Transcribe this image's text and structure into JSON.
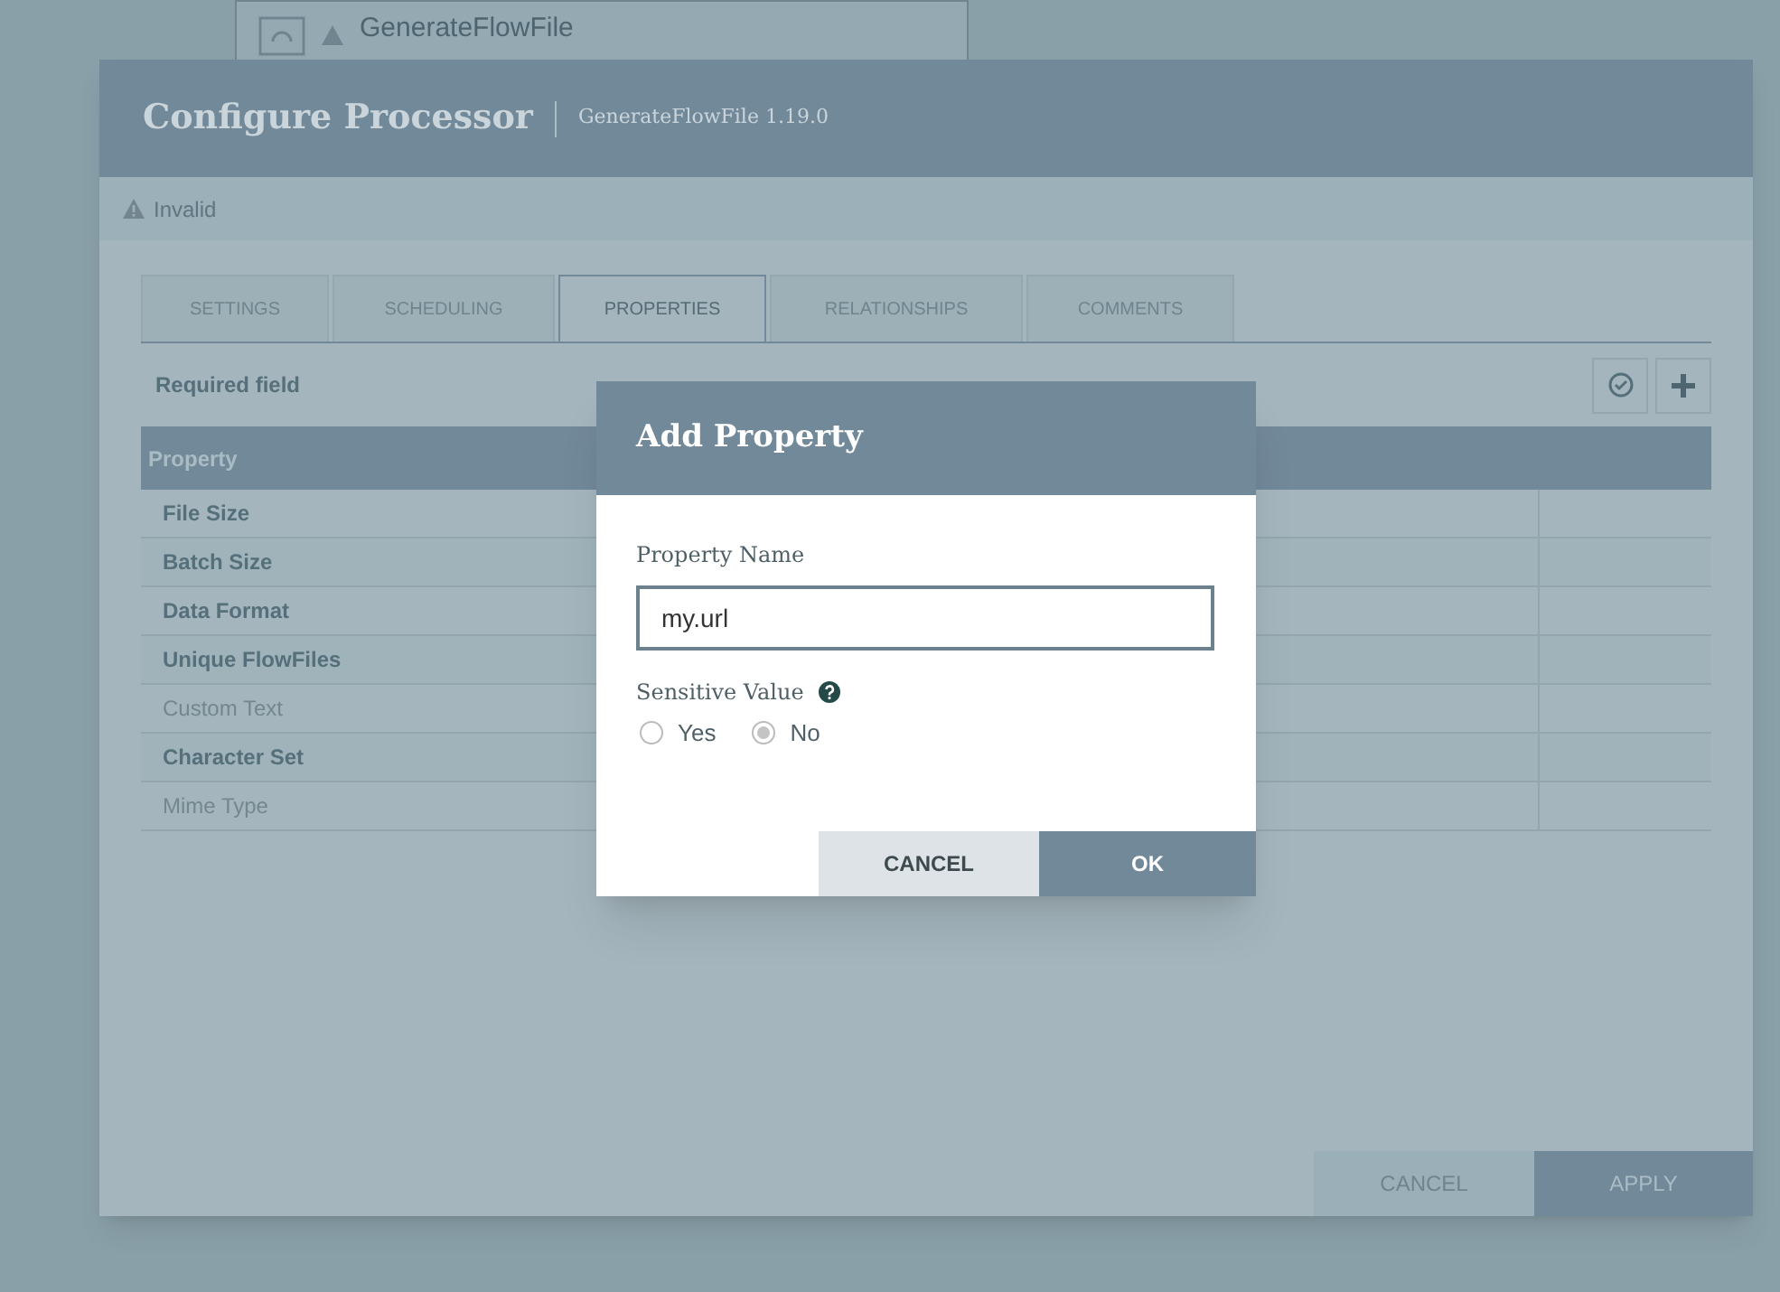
{
  "canvas_processor": {
    "name": "GenerateFlowFile"
  },
  "dialog": {
    "title": "Configure Processor",
    "subtitle": "GenerateFlowFile 1.19.0",
    "status": "Invalid",
    "tabs": [
      {
        "label": "SETTINGS",
        "selected": false
      },
      {
        "label": "SCHEDULING",
        "selected": false
      },
      {
        "label": "PROPERTIES",
        "selected": true
      },
      {
        "label": "RELATIONSHIPS",
        "selected": false
      },
      {
        "label": "COMMENTS",
        "selected": false
      }
    ],
    "required_note": "Required field",
    "table": {
      "columns": [
        "Property"
      ],
      "rows": [
        {
          "name": "File Size",
          "required": true
        },
        {
          "name": "Batch Size",
          "required": true
        },
        {
          "name": "Data Format",
          "required": true
        },
        {
          "name": "Unique FlowFiles",
          "required": true
        },
        {
          "name": "Custom Text",
          "required": false
        },
        {
          "name": "Character Set",
          "required": true
        },
        {
          "name": "Mime Type",
          "required": false
        }
      ]
    },
    "buttons": [
      "CANCEL",
      "APPLY"
    ]
  },
  "add_property": {
    "title": "Add Property",
    "field_label": "Property Name",
    "value": "my.url",
    "sensitive_label": "Sensitive Value",
    "options": [
      {
        "label": "Yes",
        "selected": false
      },
      {
        "label": "No",
        "selected": true
      }
    ],
    "buttons": [
      "CANCEL",
      "OK"
    ]
  }
}
